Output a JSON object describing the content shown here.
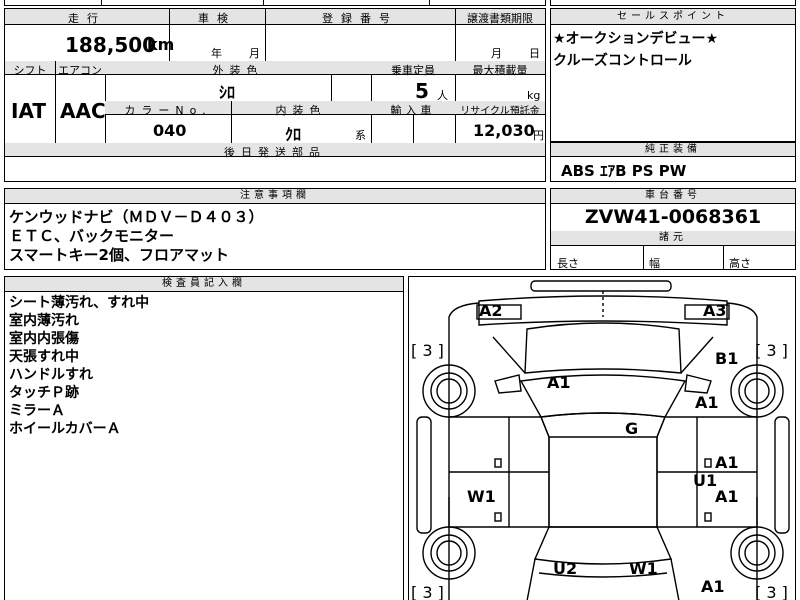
{
  "top_left": {
    "headers": {
      "mileage": "走行",
      "inspection": "車検",
      "registration": "登録番号",
      "transfer_deadline": "譲渡書類期限",
      "shift": "シフト",
      "aircon": "エアコン",
      "exterior_color": "外装色",
      "capacity": "乗車定員",
      "max_load": "最大積載量",
      "color_no": "カラーNo.",
      "interior_color": "内装色",
      "import": "輸入車",
      "recycle": "リサイクル預託金",
      "later_parts": "後日発送部品"
    },
    "mileage_value": "188,500",
    "mileage_unit": "km",
    "inspection_year": "年",
    "inspection_month": "月",
    "deadline_month": "月",
    "deadline_day": "日",
    "shift_value": "IAT",
    "aircon_value": "AAC",
    "exterior_color_value": "ｼﾛ",
    "capacity_value": "5",
    "capacity_unit": "人",
    "max_load_unit": "kg",
    "color_no_value": "040",
    "interior_color_value": "ｸﾛ",
    "interior_suffix": "系",
    "recycle_value": "12,030",
    "recycle_unit": "円"
  },
  "sales_points": {
    "header": "セールスポイント",
    "lines": [
      "★オークションデビュー★",
      "クルーズコントロール"
    ]
  },
  "equipment": {
    "header": "純正装備",
    "value": "ABS ｴｱB PS PW"
  },
  "notes": {
    "header": "注意事項欄",
    "lines": [
      "ケンウッドナビ（ＭＤＶ－Ｄ４０３）",
      "ＥＴＣ、バックモニター",
      "スマートキー2個、フロアマット"
    ]
  },
  "chassis": {
    "header": "車台番号",
    "value": "ZVW41-0068361",
    "dims_header": "諸元",
    "length": "長さ",
    "width": "幅",
    "height": "高さ"
  },
  "inspector": {
    "header": "検査員記入欄",
    "lines": [
      "シート薄汚れ、すれ中",
      "室内薄汚れ",
      "室内内張傷",
      "天張すれ中",
      "ハンドルすれ",
      "タッチＰ跡",
      "ミラーＡ",
      "ホイールカバーＡ"
    ]
  },
  "diagram": {
    "marks": [
      "A2",
      "A3",
      "B1",
      "A1",
      "A1",
      "G",
      "A1",
      "U1",
      "A1",
      "W1",
      "U2",
      "W1",
      "A1"
    ],
    "tire_labels": [
      "[ 3 ]",
      "[ 3 ]",
      "[ 3 ]",
      "[ 3 ]"
    ]
  }
}
